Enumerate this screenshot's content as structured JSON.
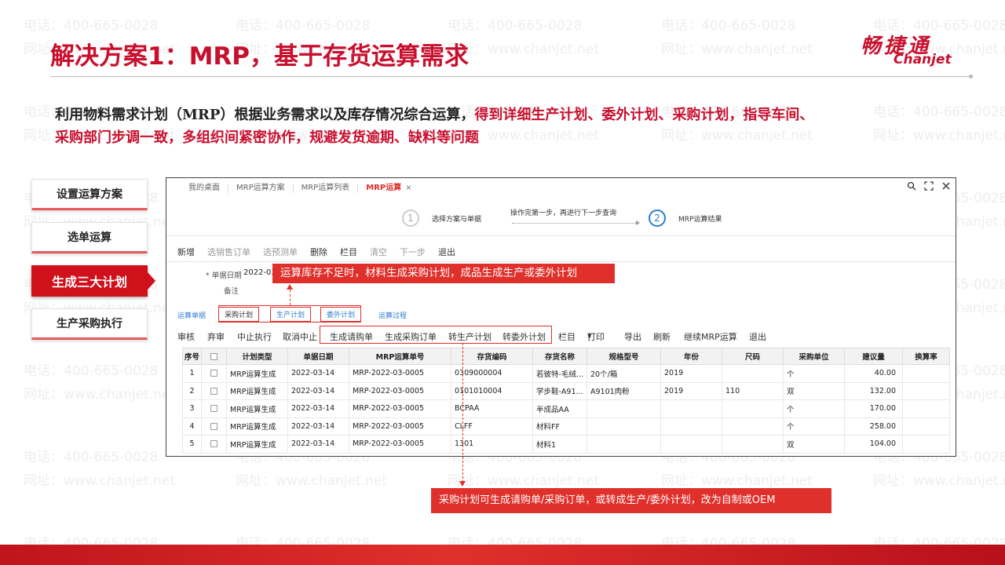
{
  "slide": {
    "title": "解决方案1：MRP，基于存货运算需求",
    "logo_cn": "畅捷通",
    "logo_en": "Chanjet",
    "desc_normal": "利用物料需求计划（MRP）根据业务需求以及库存情况综合运算，",
    "desc_red1": "得到详细生产计划、委外计划、采购计划，指导车间、",
    "desc_red2": "采购部门步调一致，多组织间紧密协作，规避发货逾期、缺料等问题",
    "watermark_phone": "电话：400-665-0028",
    "watermark_site": "网址：www.chanjet.net",
    "accent_color": "#c8102e"
  },
  "steps": [
    {
      "label": "设置运算方案",
      "active": false
    },
    {
      "label": "选单运算",
      "active": false
    },
    {
      "label": "生成三大计划",
      "active": true
    },
    {
      "label": "生产采购执行",
      "active": false
    }
  ],
  "app": {
    "tabs": [
      "我的桌面",
      "MRP运算方案",
      "MRP运算列表",
      "MRP运算"
    ],
    "active_tab_close": "×",
    "win_icons": [
      "search-icon",
      "maximize-icon",
      "close-icon"
    ],
    "wizard": {
      "step1_num": "1",
      "step1_label": "选择方案与单据",
      "hint": "操作完第一步，再进行下一步查询",
      "step2_num": "2",
      "step2_label": "MRP运算结果"
    },
    "toolbar1": [
      "新增",
      "选销售订单",
      "选预测单",
      "删除",
      "栏目",
      "清空",
      "下一步",
      "退出"
    ],
    "form": {
      "date_label": "* 单据日期",
      "date_value": "2022-03",
      "remark_label": "备注"
    },
    "subtabs": [
      "运算单据",
      "采购计划",
      "生产计划",
      "委外计划",
      "运算过程"
    ],
    "toolbar2": [
      "审核",
      "弃审",
      "中止执行",
      "取消中止",
      "生成请购单",
      "生成采购订单",
      "转生产计划",
      "转委外计划",
      "栏目",
      "打印",
      "导出",
      "刷新",
      "继续MRP运算",
      "退出"
    ],
    "print_arrow": "▾",
    "table": {
      "headers": [
        "序号",
        "",
        "计划类型",
        "单据日期",
        "MRP运算单号",
        "存货编码",
        "存货名称",
        "规格型号",
        "年份",
        "尺码",
        "采购单位",
        "建议量",
        "换算率"
      ],
      "rows": [
        [
          "1",
          "",
          "MRP运算生成",
          "2022-03-14",
          "MRP-2022-03-0005",
          "0309000004",
          "若彼特-毛绒...",
          "20个/箱",
          "2019",
          "",
          "个",
          "40.00",
          ""
        ],
        [
          "2",
          "",
          "MRP运算生成",
          "2022-03-14",
          "MRP-2022-03-0005",
          "0101010004",
          "学步鞋-A91...",
          "A9101肉粉",
          "2019",
          "110",
          "双",
          "132.00",
          ""
        ],
        [
          "3",
          "",
          "MRP运算生成",
          "2022-03-14",
          "MRP-2022-03-0005",
          "BCPAA",
          "半成品AA",
          "",
          "",
          "",
          "个",
          "170.00",
          ""
        ],
        [
          "4",
          "",
          "MRP运算生成",
          "2022-03-14",
          "MRP-2022-03-0005",
          "CLFF",
          "材料FF",
          "",
          "",
          "",
          "个",
          "258.00",
          ""
        ],
        [
          "5",
          "",
          "MRP运算生成",
          "2022-03-14",
          "MRP-2022-03-0005",
          "1301",
          "材料1",
          "",
          "",
          "",
          "双",
          "104.00",
          ""
        ]
      ]
    }
  },
  "callouts": {
    "top": "运算库存不足时，材料生成采购计划，成品生成生产或委外计划",
    "bottom": "采购计划可生成请购单/采购订单，或转成生产/委外计划，改为自制或OEM"
  }
}
